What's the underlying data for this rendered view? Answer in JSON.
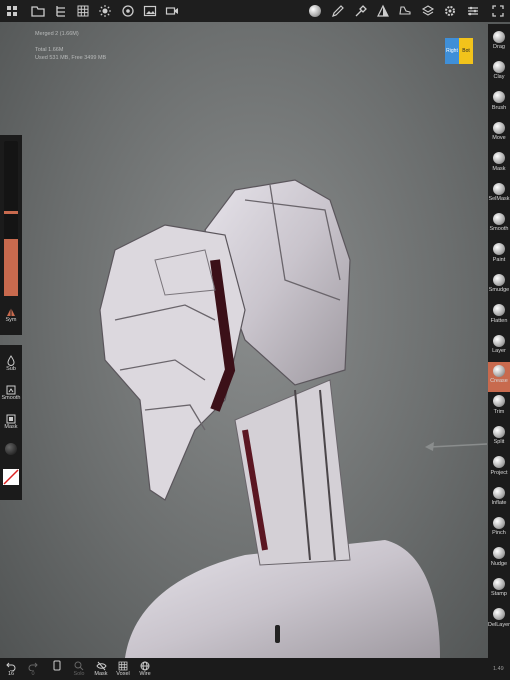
{
  "info": {
    "mesh_name": "Merged 2 (1.66M)",
    "total": "Total 1.66M",
    "memory": "Used 531 MB, Free 3499 MB"
  },
  "view_cube": {
    "left_label": "Right",
    "right_label": "Bot"
  },
  "tools": [
    {
      "label": "Drag"
    },
    {
      "label": "Clay"
    },
    {
      "label": "Brush"
    },
    {
      "label": "Move"
    },
    {
      "label": "Mask"
    },
    {
      "label": "SelMask"
    },
    {
      "label": "Smooth"
    },
    {
      "label": "Paint"
    },
    {
      "label": "Smudge"
    },
    {
      "label": "Flatten"
    },
    {
      "label": "Layer"
    },
    {
      "label": "Crease"
    },
    {
      "label": "Trim"
    },
    {
      "label": "Split"
    },
    {
      "label": "Project"
    },
    {
      "label": "Inflate"
    },
    {
      "label": "Pinch"
    },
    {
      "label": "Nudge"
    },
    {
      "label": "Stamp"
    },
    {
      "label": "DelLayer"
    }
  ],
  "active_tool": "Crease",
  "left": {
    "sym_label": "Sym",
    "sub_label": "Sub",
    "smooth_label": "Smooth",
    "mask_label": "Mask"
  },
  "bottom": {
    "undo_count": "16",
    "redo_count": "0",
    "solo_label": "Solo",
    "mask_label": "Mask",
    "voxel_label": "Voxel",
    "wire_label": "Wire",
    "version": "1.49"
  },
  "colors": {
    "accent": "#c86a4e",
    "panel": "#1b1b1b",
    "view_right": "#3f8fd8",
    "view_bot": "#f2c31b"
  }
}
